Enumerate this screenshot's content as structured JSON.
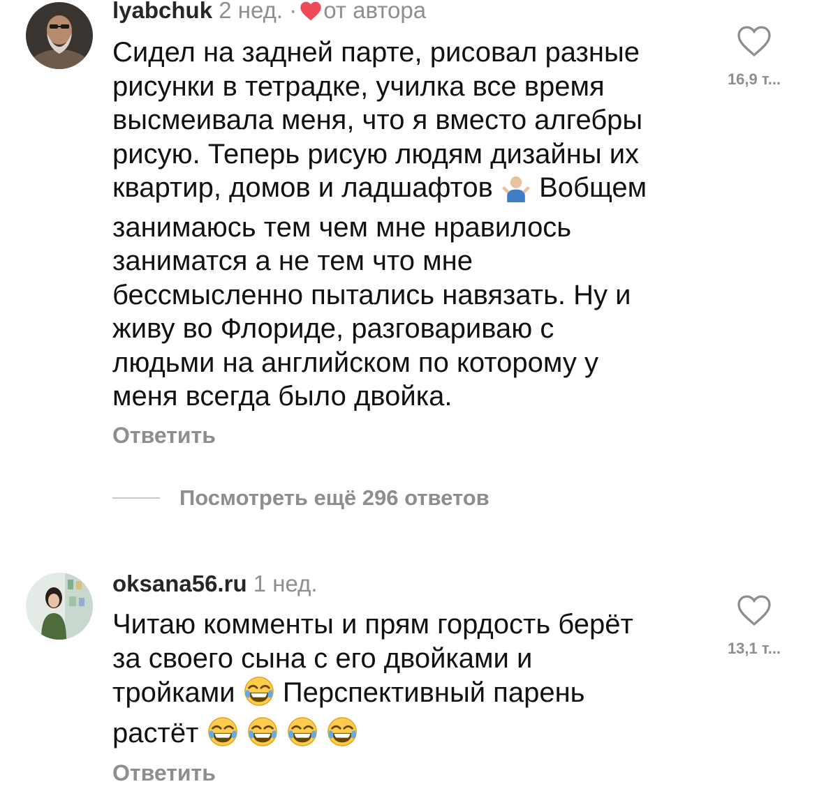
{
  "comments": [
    {
      "username": "lyabchuk",
      "time": "2 нед.",
      "separator": "·",
      "author_tag": "от автора",
      "lines": [
        "Сидел на задней парте, рисовал разные",
        "рисунки в тетрадке, училка все время",
        "высмеивала меня, что я вместо алгебры",
        "рисую. Теперь рисую людям дизайны их",
        "квартир, домов и ладшафтов",
        "Вобщем",
        "занимаюсь тем чем мне нравилось",
        "заниматся а не тем что мне",
        "бессмысленно пытались навязать. Ну и",
        "живу во Флориде, разговариваю с",
        "людьми на английском по которому у",
        "меня всегда было двойка."
      ],
      "emoji": "person-shrugging-emoji",
      "likes": "16,9 т...",
      "reply_label": "Ответить"
    },
    {
      "username": "oksana56.ru",
      "time": "1 нед.",
      "lines": [
        "Читаю комменты и прям гордость берёт",
        "за своего сына с его двойками и",
        "тройками",
        "Перспективный парень",
        "растёт"
      ],
      "emoji": "face-with-tears-of-joy-emoji",
      "likes": "13,1 т...",
      "reply_label": "Ответить"
    }
  ],
  "view_more_replies": "Посмотреть ещё 296 ответов",
  "colors": {
    "text": "#111111",
    "secondary": "#8e8e8e",
    "author_heart": "#ed4956"
  }
}
